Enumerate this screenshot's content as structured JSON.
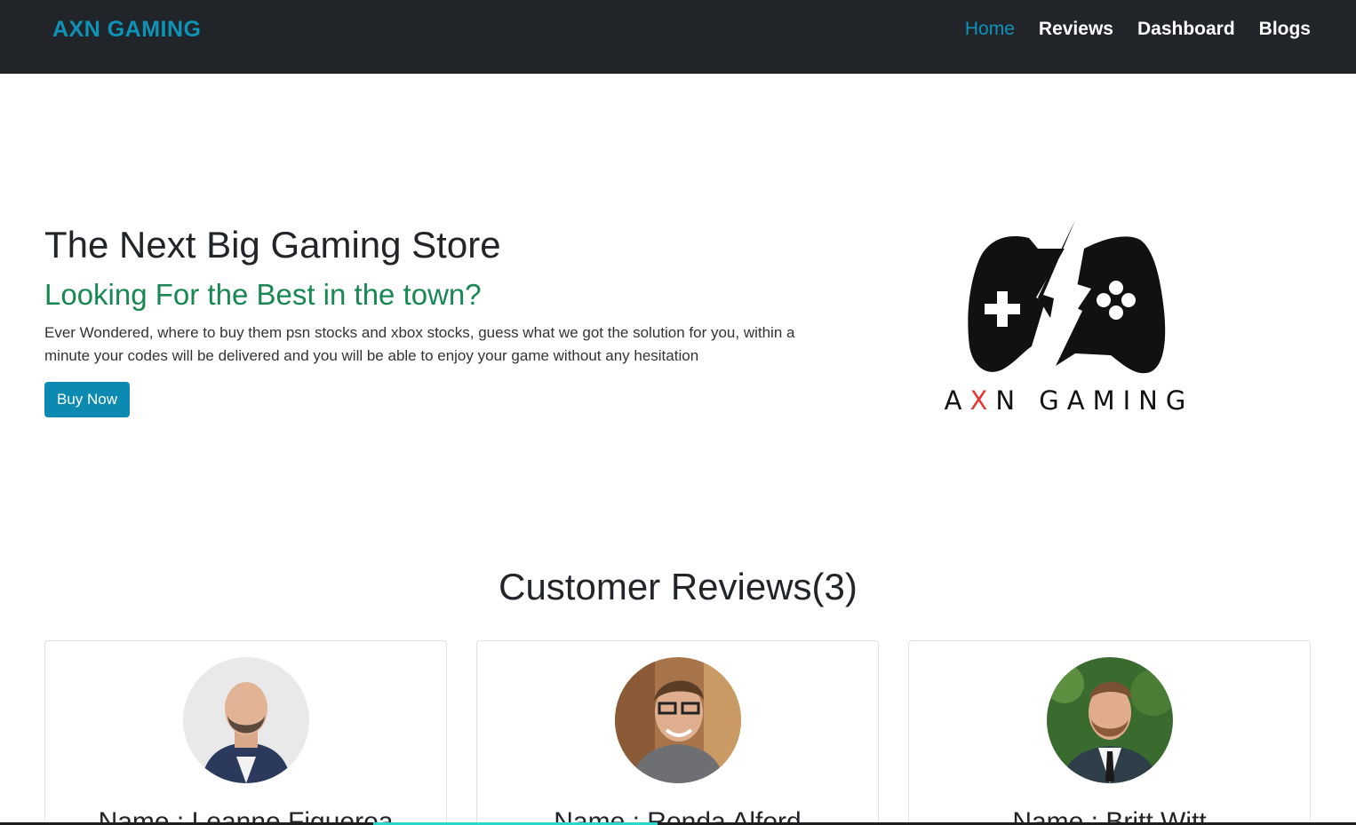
{
  "navbar": {
    "brand": "AXN GAMING",
    "links": [
      {
        "label": "Home",
        "active": true
      },
      {
        "label": "Reviews",
        "active": false
      },
      {
        "label": "Dashboard",
        "active": false
      },
      {
        "label": "Blogs",
        "active": false
      }
    ]
  },
  "hero": {
    "title": "The Next Big Gaming Store",
    "subtitle": "Looking For the Best in the town?",
    "description": "Ever Wondered, where to buy them psn stocks and xbox stocks, guess what we got the solution for you, within a minute your codes will be delivered and you will be able to enjoy your game without any hesitation",
    "button_label": "Buy Now",
    "logo_text_parts": [
      "A",
      "X",
      "N GAMING"
    ]
  },
  "reviews": {
    "title": "Customer Reviews(3)",
    "items": [
      {
        "name": "Name : Leanne Figueroa"
      },
      {
        "name": "Name : Ronda Alford"
      },
      {
        "name": "Name : Britt Witt"
      }
    ]
  },
  "colors": {
    "navbar_bg": "#212529",
    "accent": "#0d93b8",
    "subtitle": "#198754",
    "button": "#0d8ab1",
    "logo_x": "#e53935"
  }
}
